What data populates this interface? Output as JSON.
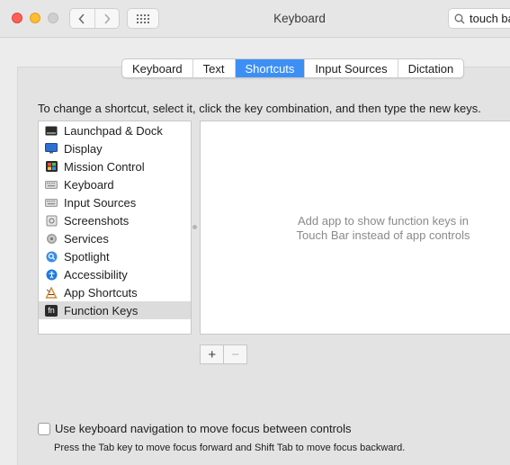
{
  "window": {
    "title": "Keyboard",
    "search_value": "touch ba"
  },
  "toolbar_icons": {
    "back": "chevron-left-icon",
    "forward": "chevron-right-icon",
    "show_all": "grid-icon",
    "search": "magnifier-icon"
  },
  "tabs": [
    {
      "label": "Keyboard"
    },
    {
      "label": "Text"
    },
    {
      "label": "Shortcuts"
    },
    {
      "label": "Input Sources"
    },
    {
      "label": "Dictation"
    }
  ],
  "selected_tab": "Shortcuts",
  "instructions": "To change a shortcut, select it, click the key combination, and then type the new keys.",
  "categories": [
    {
      "label": "Launchpad & Dock",
      "icon": "launchpad-dock-icon"
    },
    {
      "label": "Display",
      "icon": "display-icon"
    },
    {
      "label": "Mission Control",
      "icon": "mission-control-icon"
    },
    {
      "label": "Keyboard",
      "icon": "keyboard-icon"
    },
    {
      "label": "Input Sources",
      "icon": "input-sources-icon"
    },
    {
      "label": "Screenshots",
      "icon": "screenshots-icon"
    },
    {
      "label": "Services",
      "icon": "gear-icon"
    },
    {
      "label": "Spotlight",
      "icon": "spotlight-icon"
    },
    {
      "label": "Accessibility",
      "icon": "accessibility-icon"
    },
    {
      "label": "App Shortcuts",
      "icon": "app-shortcuts-icon"
    },
    {
      "label": "Function Keys",
      "icon": "fn-icon",
      "icon_text": "fn",
      "selected": true
    }
  ],
  "app_list": {
    "empty_message": "Add app to show function keys in Touch Bar instead of app controls"
  },
  "buttons": {
    "add": "+",
    "remove": "−"
  },
  "keyboard_navigation": {
    "label": "Use keyboard navigation to move focus between controls",
    "checked": false,
    "help": "Press the Tab key to move focus forward and Shift Tab to move focus backward."
  },
  "colors": {
    "accent": "#3c90f5",
    "close": "#fe5f57",
    "minimize": "#febc2e"
  }
}
